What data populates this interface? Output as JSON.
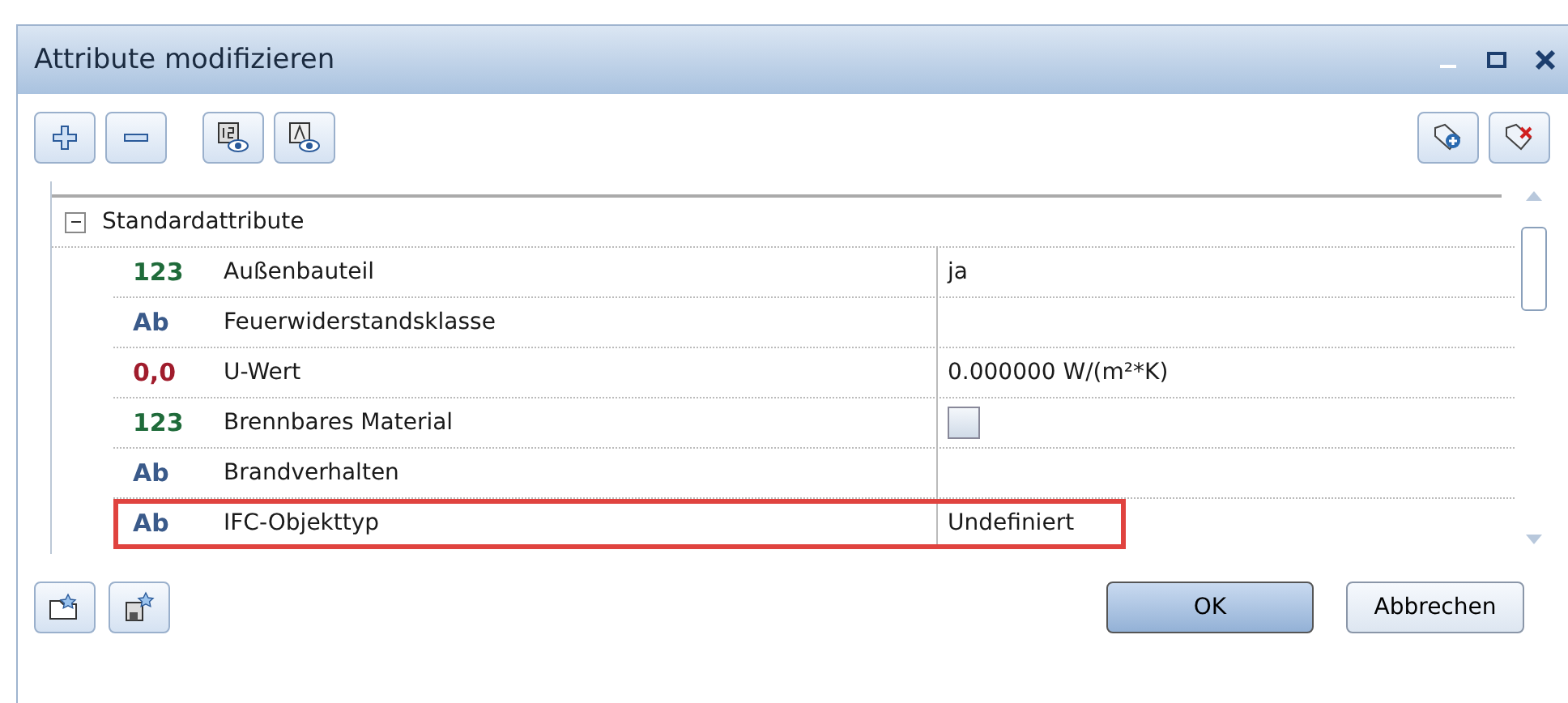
{
  "window": {
    "title": "Attribute modifizieren"
  },
  "group": {
    "label": "Standardattribute",
    "expanded": true
  },
  "rows": [
    {
      "type_label": "123",
      "kind": "integer",
      "name": "Außenbauteil",
      "value": "ja",
      "highlighted": false
    },
    {
      "type_label": "Ab",
      "kind": "text",
      "name": "Feuerwiderstandsklasse",
      "highlighted": false
    },
    {
      "type_label": "0,0",
      "kind": "real",
      "name": "U-Wert",
      "value": "0.000000 W/(m²*K)",
      "highlighted": false
    },
    {
      "type_label": "123",
      "kind": "integer",
      "name": "Brennbares Material",
      "checked": false,
      "highlighted": false
    },
    {
      "type_label": "Ab",
      "kind": "text",
      "name": "Brandverhalten",
      "highlighted": false
    },
    {
      "type_label": "Ab",
      "kind": "text",
      "name": "IFC-Objekttyp",
      "value": "Undefiniert",
      "highlighted": true
    }
  ],
  "buttons": [
    {
      "label": "OK",
      "selected": true
    },
    {
      "label": "Abbrechen",
      "selected": false
    }
  ]
}
